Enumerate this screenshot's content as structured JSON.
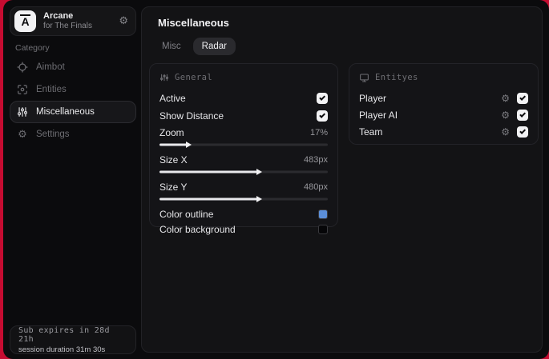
{
  "app": {
    "name": "Arcane",
    "subtitle": "for The Finals",
    "logo_letter": "A"
  },
  "sidebar": {
    "category_label": "Category",
    "items": [
      {
        "label": "Aimbot",
        "icon": "crosshair-icon",
        "active": false
      },
      {
        "label": "Entities",
        "icon": "scan-icon",
        "active": false
      },
      {
        "label": "Miscellaneous",
        "icon": "sliders-icon",
        "active": true
      },
      {
        "label": "Settings",
        "icon": "gear-icon",
        "active": false
      }
    ],
    "footer": {
      "line1": "Sub expires in 28d 21h",
      "line2": "session duration 31m 30s"
    }
  },
  "main": {
    "title": "Miscellaneous",
    "tabs": [
      {
        "label": "Misc",
        "active": false
      },
      {
        "label": "Radar",
        "active": true
      }
    ],
    "general": {
      "header": "General",
      "toggles": [
        {
          "label": "Active",
          "checked": true
        },
        {
          "label": "Show Distance",
          "checked": true
        }
      ],
      "sliders": [
        {
          "label": "Zoom",
          "value": "17%",
          "percent": 17
        },
        {
          "label": "Size X",
          "value": "483px",
          "percent": 59
        },
        {
          "label": "Size Y",
          "value": "480px",
          "percent": 59
        }
      ],
      "colors": [
        {
          "label": "Color outline",
          "hex": "#5b8ed8"
        },
        {
          "label": "Color background",
          "hex": "#060608"
        }
      ]
    },
    "entities": {
      "header": "Entityes",
      "rows": [
        {
          "label": "Player",
          "checked": true
        },
        {
          "label": "Player AI",
          "checked": true
        },
        {
          "label": "Team",
          "checked": true
        }
      ]
    }
  },
  "colors": {
    "backdrop": "#c60c31",
    "accent_blue": "#5b8ed8"
  },
  "glyphs": {
    "gear": "⚙"
  }
}
